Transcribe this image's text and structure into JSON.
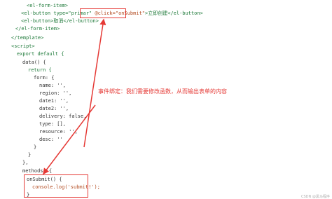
{
  "code": {
    "l1": "<el-form-item>",
    "l2_pre": "<el-button type=\"primar\" ",
    "l2_click": "@click=\"onSubmit\"",
    "l2_post": ">立即创建</el-button>",
    "l3": "<el-button>取消</el-button>",
    "l4": "</el-form-item>",
    "l5": "</template>",
    "l6": "<script>",
    "l7": "export default {",
    "l8": "data() {",
    "l9": "return {",
    "l10": "form: {",
    "l11": "name: '',",
    "l12": "region: '',",
    "l13": "date1: '',",
    "l14": "date2: '',",
    "l15": "delivery: false,",
    "l16": "type: [],",
    "l17": "resource: '',",
    "l18": "desc: ''",
    "l19": "}",
    "l20": "}",
    "l21": "},",
    "l22": "methods: {",
    "l23": "onSubmit() {",
    "l24": "console.log('submit!');",
    "l25": "}"
  },
  "annotation": "事件绑定：我们需要修改函数，从而输出表单的内容",
  "watermark": "CSDN @黑马程序",
  "colors": {
    "highlight": "#e53935",
    "tag": "#1f7a3a",
    "string": "#b24a1f"
  }
}
